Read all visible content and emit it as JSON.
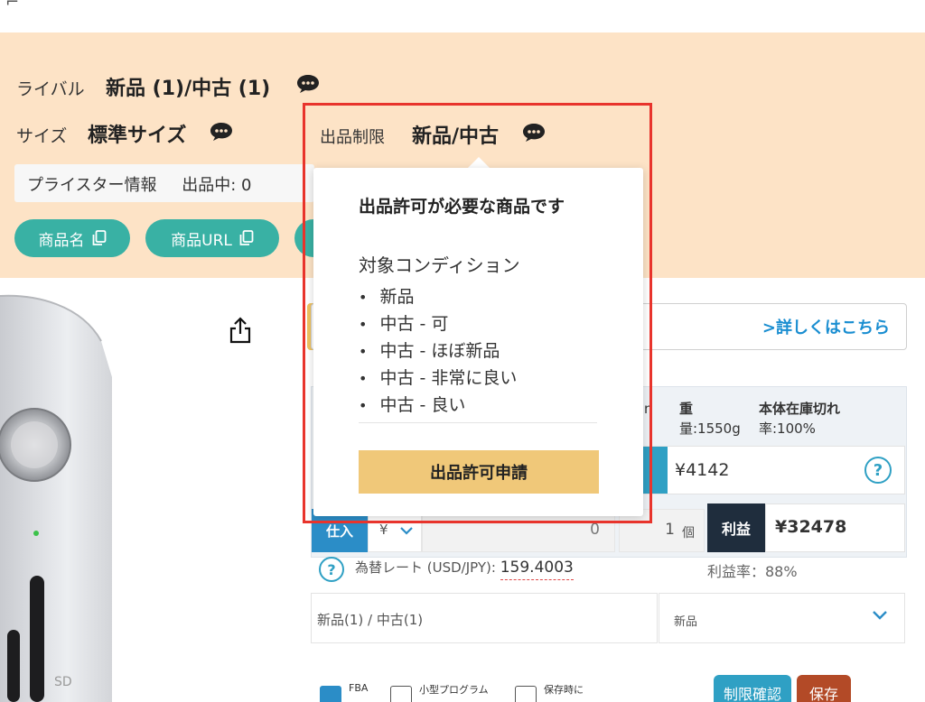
{
  "header": {
    "rival_label": "ライバル",
    "rival_value": "新品 (1)/中古 (1)",
    "size_label": "サイズ",
    "size_value": "標準サイズ",
    "restriction_label": "出品制限",
    "restriction_value": "新品/中古"
  },
  "pricester": {
    "label": "プライスター情報",
    "listing": "出品中: 0"
  },
  "copy_buttons": [
    {
      "label": "商品名"
    },
    {
      "label": "商品URL"
    }
  ],
  "detail_link": ">詳しくはこちら",
  "specs": {
    "weight_line1": "重",
    "weight_line2": "量:1550g",
    "stockout_line1": "本体在庫切れ",
    "stockout_line2": "率:100%",
    "partial_n": "n"
  },
  "fee_value": "¥4142",
  "buy": {
    "label": "仕入",
    "currency": "¥",
    "price": "0",
    "qty": "1",
    "unit": "個"
  },
  "profit": {
    "label": "利益",
    "value": "¥32478",
    "margin": "利益率：88%"
  },
  "rate": {
    "label": "為替レート (USD/JPY):",
    "value": "159.4003"
  },
  "condition": {
    "summary": "新品(1) / 中古(1)",
    "selected": "新品"
  },
  "checkboxes": [
    {
      "label": "FBA",
      "checked": true
    },
    {
      "label": "小型プログラム",
      "checked": false
    },
    {
      "label": "保存時に",
      "checked": false
    }
  ],
  "buttons": {
    "restriction_check": "制限確認",
    "save": "保存"
  },
  "popover": {
    "title": "出品許可が必要な商品です",
    "subtitle": "対象コンディション",
    "conditions": [
      "新品",
      "中古 - 可",
      "中古 - ほぼ新品",
      "中古 - 非常に良い",
      "中古 - 良い"
    ],
    "apply_button": "出品許可申請"
  },
  "device": {
    "slot_label": "SD"
  },
  "colors": {
    "band": "#fde3c6",
    "teal": "#39b1a4",
    "highlight": "#e8342c",
    "apply": "#f0c879",
    "link": "#1a8ed1"
  },
  "icons": [
    "chat-bubble-icon",
    "copy-icon",
    "share-icon",
    "help-icon",
    "chevron-down-icon"
  ]
}
